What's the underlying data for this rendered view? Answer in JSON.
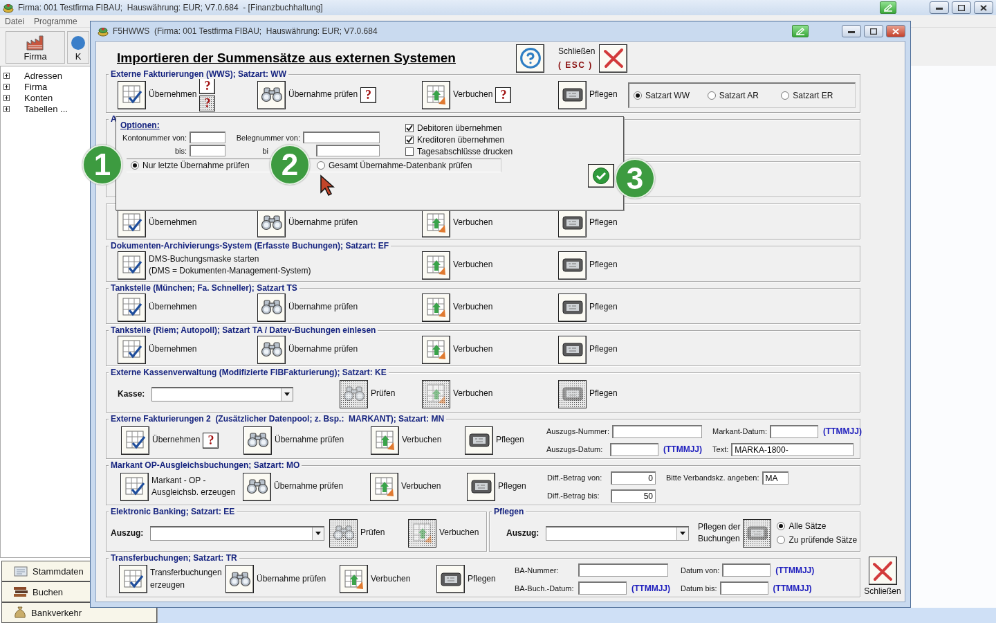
{
  "app": {
    "title": "Firma: 001 Testfirma FIBAU;  Hauswährung: EUR; V7.0.684  - [Finanzbuchhaltung]",
    "menu": [
      "Datei",
      "Programme"
    ],
    "toolbar": [
      {
        "label": "Firma",
        "kind": "factory"
      },
      {
        "label": "K",
        "kind": "globe"
      }
    ],
    "tree": [
      {
        "label": "Adressen",
        "expanded": false
      },
      {
        "label": "Firma",
        "expanded": false
      },
      {
        "label": "Konten",
        "expanded": false
      },
      {
        "label": "Tabellen ...",
        "expanded": false
      }
    ],
    "nav": [
      {
        "label": "Stammdaten",
        "kind": "cards"
      },
      {
        "label": "Buchen",
        "kind": "books"
      },
      {
        "label": "Bankverkehr",
        "kind": "bag"
      }
    ]
  },
  "dialog": {
    "title": "F5HWWS  (Firma: 001 Testfirma FIBAU;  Hauswährung: EUR; V7.0.684",
    "heading": "Importieren der Summensätze aus externen Systemen",
    "close_label": "Schließen",
    "close_shortcut": "( ESC )",
    "footer_close_label": "Schließen",
    "sections": [
      {
        "kind": "standard",
        "title": "Externe Fakturierungen (WWS); Satzart: WW",
        "actions": [
          {
            "kind": "grid-check",
            "label": "Übernehmen",
            "disabled": false,
            "help": [
              {
                "label": "?",
                "disabled": false
              },
              {
                "label": "?",
                "disabled": true
              }
            ]
          },
          {
            "kind": "binoculars",
            "label": "Übernahme prüfen",
            "disabled": false,
            "help": [
              {
                "label": "?",
                "disabled": false
              }
            ]
          },
          {
            "kind": "grid-arrow",
            "label": "Verbuchen",
            "disabled": false,
            "help": [
              {
                "label": "?",
                "disabled": false
              }
            ]
          },
          {
            "kind": "device",
            "label": "Pflegen",
            "disabled": false
          }
        ],
        "radios": [
          {
            "label": "Satzart WW",
            "selected": true
          },
          {
            "label": "Satzart AR",
            "selected": false
          },
          {
            "label": "Satzart ER",
            "selected": false
          }
        ]
      },
      {
        "kind": "empty",
        "title": "A"
      },
      {
        "kind": "empty"
      },
      {
        "kind": "standard",
        "actions": [
          {
            "kind": "grid-check",
            "label": "Übernehmen",
            "disabled": false
          },
          {
            "kind": "binoculars",
            "label": "Übernahme prüfen",
            "disabled": false
          },
          {
            "kind": "grid-arrow",
            "label": "Verbuchen",
            "disabled": false
          },
          {
            "kind": "device",
            "label": "Pflegen",
            "disabled": false
          }
        ]
      },
      {
        "kind": "ef",
        "title": "Dokumenten-Archivierungs-System (Erfasste Buchungen); Satzart: EF",
        "actions": [
          {
            "kind": "grid-check",
            "label": "DMS-Buchungsmaske starten\n(DMS = Dokumenten-Management-System)",
            "disabled": false
          },
          {
            "kind": "grid-arrow",
            "label": "Verbuchen",
            "disabled": false
          },
          {
            "kind": "device",
            "label": "Pflegen",
            "disabled": false
          }
        ]
      },
      {
        "kind": "standard",
        "title": "Tankstelle (München; Fa. Schneller); Satzart TS",
        "actions": [
          {
            "kind": "grid-check",
            "label": "Übernehmen",
            "disabled": false
          },
          {
            "kind": "binoculars",
            "label": "Übernahme prüfen",
            "disabled": false
          },
          {
            "kind": "grid-arrow",
            "label": "Verbuchen",
            "disabled": false
          },
          {
            "kind": "device",
            "label": "Pflegen",
            "disabled": false
          }
        ]
      },
      {
        "kind": "standard",
        "title": "Tankstelle (Riem; Autopoll); Satzart TA / Datev-Buchungen einlesen",
        "actions": [
          {
            "kind": "grid-check",
            "label": "Übernehmen",
            "disabled": false
          },
          {
            "kind": "binoculars",
            "label": "Übernahme prüfen",
            "disabled": false
          },
          {
            "kind": "grid-arrow",
            "label": "Verbuchen",
            "disabled": false
          },
          {
            "kind": "device",
            "label": "Pflegen",
            "disabled": false
          }
        ]
      },
      {
        "kind": "ke",
        "title": "Externe Kassenverwaltung (Modifizierte FIBFakturierung); Satzart: KE",
        "combo": {
          "label": "Kasse:"
        },
        "actions": [
          {
            "kind": "binoculars",
            "label": "Prüfen",
            "disabled": true
          },
          {
            "kind": "grid-arrow",
            "label": "Verbuchen",
            "disabled": true
          },
          {
            "kind": "device",
            "label": "Pflegen",
            "disabled": true
          }
        ]
      },
      {
        "kind": "mn",
        "title": "Externe Fakturierungen 2  (Zusätzlicher Datenpool; z. Bsp.:  MARKANT); Satzart: MN",
        "actions": [
          {
            "kind": "grid-check",
            "label": "Übernehmen",
            "disabled": false,
            "help": [
              {
                "label": "?",
                "disabled": false
              }
            ]
          },
          {
            "kind": "binoculars",
            "label": "Übernahme prüfen",
            "disabled": false
          },
          {
            "kind": "grid-arrow",
            "label": "Verbuchen",
            "disabled": false
          },
          {
            "kind": "device",
            "label": "Pflegen",
            "disabled": false
          }
        ],
        "field_columns": [
          [
            {
              "label": "Auszugs-Nummer:",
              "kind": "wide"
            },
            {
              "label": "Auszugs-Datum:",
              "kind": "date",
              "suffix": "(TTMMJJ)"
            }
          ],
          [
            {
              "label": "Markant-Datum:",
              "kind": "date",
              "suffix": "(TTMMJJ)"
            },
            {
              "label": "Text:",
              "kind": "text",
              "value": "MARKA-1800-"
            }
          ]
        ]
      },
      {
        "kind": "mo",
        "title": "Markant OP-Ausgleichsbuchungen; Satzart: MO",
        "actions": [
          {
            "kind": "grid-check",
            "label": "Markant - OP -\nAusgleichsb. erzeugen",
            "disabled": false
          },
          {
            "kind": "binoculars",
            "label": "Übernahme prüfen",
            "disabled": false
          },
          {
            "kind": "grid-arrow",
            "label": "Verbuchen",
            "disabled": false
          },
          {
            "kind": "device",
            "label": "Pflegen",
            "disabled": false
          }
        ],
        "field_columns": [
          [
            {
              "label": "Diff.-Betrag von:",
              "kind": "number",
              "value": "0"
            },
            {
              "label": "Diff.-Betrag bis:",
              "kind": "number",
              "value": "50"
            }
          ],
          [
            {
              "label": "Bitte Verbandskz. angeben:",
              "kind": "short",
              "value": "MA"
            }
          ]
        ]
      },
      {
        "kind": "split",
        "groups": [
          {
            "kind": "ee",
            "title": "Elektronic Banking; Satzart: EE",
            "combo": {
              "label": "Auszug:"
            },
            "actions": [
              {
                "kind": "binoculars",
                "label": "Prüfen",
                "disabled": true
              },
              {
                "kind": "grid-arrow",
                "label": "Verbuchen",
                "disabled": true
              }
            ]
          },
          {
            "kind": "pflegen",
            "title": "Pflegen",
            "combo": {
              "label": "Auszug:"
            },
            "actions": [
              {
                "kind": "device",
                "label": "Pflegen der\nBuchungen",
                "disabled": true
              }
            ],
            "radios": [
              {
                "label": "Alle Sätze",
                "selected": true
              },
              {
                "label": "Zu prüfende Sätze",
                "selected": false
              }
            ]
          }
        ]
      },
      {
        "kind": "tr",
        "title": "Transferbuchungen; Satzart: TR",
        "actions": [
          {
            "kind": "grid-check",
            "label": "Transferbuchungen\nerzeugen",
            "disabled": false
          },
          {
            "kind": "binoculars",
            "label": "Übernahme prüfen",
            "disabled": false
          },
          {
            "kind": "grid-arrow",
            "label": "Verbuchen",
            "disabled": false
          },
          {
            "kind": "device",
            "label": "Pflegen",
            "disabled": false
          }
        ],
        "field_columns": [
          [
            {
              "label": "BA-Nummer:",
              "kind": "wide"
            },
            {
              "label": "BA-Buch.-Datum:",
              "kind": "date",
              "suffix": "(TTMMJJ)"
            }
          ],
          [
            {
              "label": "Datum von:",
              "kind": "date",
              "suffix": "(TTMMJJ)"
            },
            {
              "label": "Datum bis:",
              "kind": "date",
              "suffix": "(TTMMJJ)"
            }
          ]
        ]
      }
    ]
  },
  "options": {
    "title": "Optionen:",
    "fields": [
      {
        "label": "Kontonummer von:"
      },
      {
        "label": "Belegnummer von:"
      },
      {
        "label": "bis:"
      },
      {
        "label": "bi"
      }
    ],
    "checks": [
      {
        "label": "Debitoren übernehmen",
        "checked": true
      },
      {
        "label": "Kreditoren übernehmen",
        "checked": true
      },
      {
        "label": "Tagesabschlüsse drucken",
        "checked": false
      }
    ],
    "radios": [
      {
        "label": "Nur letzte Übernahme prüfen",
        "selected": true
      },
      {
        "label": "Gesamt Übernahme-Datenbank prüfen",
        "selected": false
      }
    ]
  },
  "badges": [
    "1",
    "2",
    "3"
  ]
}
